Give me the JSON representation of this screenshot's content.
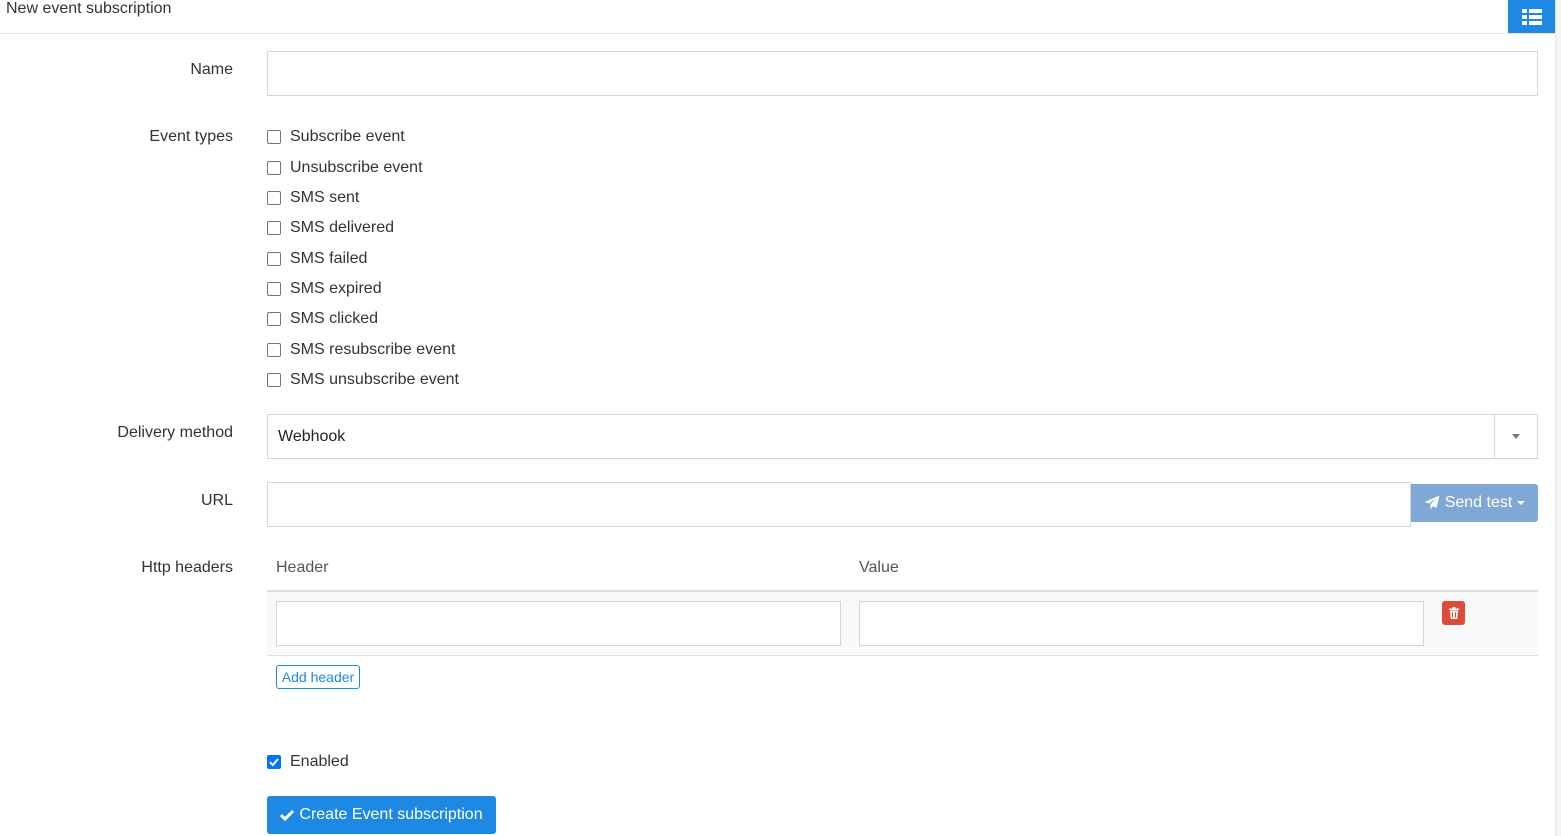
{
  "header": {
    "title": "New event subscription",
    "list_button_icon": "list-icon"
  },
  "form": {
    "name_label": "Name",
    "name_value": "",
    "event_types_label": "Event types",
    "event_types": [
      {
        "label": "Subscribe event",
        "checked": false
      },
      {
        "label": "Unsubscribe event",
        "checked": false
      },
      {
        "label": "SMS sent",
        "checked": false
      },
      {
        "label": "SMS delivered",
        "checked": false
      },
      {
        "label": "SMS failed",
        "checked": false
      },
      {
        "label": "SMS expired",
        "checked": false
      },
      {
        "label": "SMS clicked",
        "checked": false
      },
      {
        "label": "SMS resubscribe event",
        "checked": false
      },
      {
        "label": "SMS unsubscribe event",
        "checked": false
      }
    ],
    "delivery_method_label": "Delivery method",
    "delivery_method_value": "Webhook",
    "url_label": "URL",
    "url_value": "",
    "send_test_label": "Send test",
    "http_headers_label": "Http headers",
    "headers_table": {
      "columns": [
        "Header",
        "Value"
      ],
      "rows": [
        {
          "header": "",
          "value": ""
        }
      ]
    },
    "add_header_label": "Add header",
    "enabled_label": "Enabled",
    "enabled_checked": true,
    "submit_label": "Create Event subscription"
  },
  "colors": {
    "primary": "#1e88e5",
    "send_test_bg": "#7fa8d4",
    "danger": "#dd4b39"
  }
}
